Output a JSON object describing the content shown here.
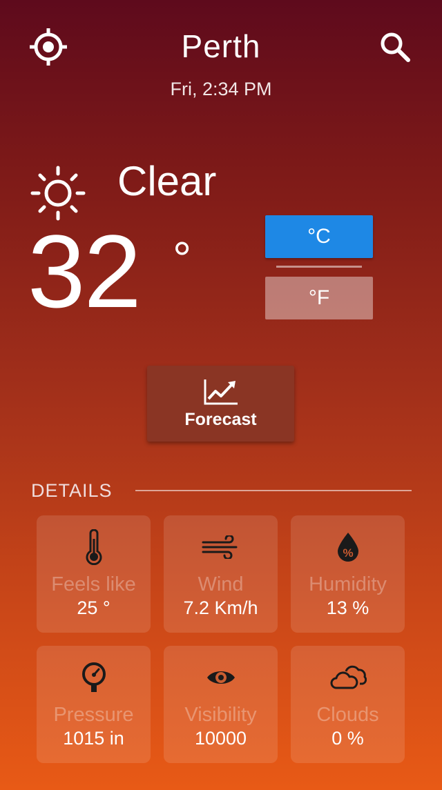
{
  "header": {
    "city": "Perth",
    "datetime": "Fri, 2:34 PM"
  },
  "current": {
    "condition": "Clear",
    "temperature": "32",
    "degree_symbol": "°",
    "condition_icon": "sun-icon"
  },
  "units": {
    "celsius": "°C",
    "fahrenheit": "°F",
    "selected": "celsius"
  },
  "forecast_button": {
    "label": "Forecast",
    "icon": "trending-chart-icon"
  },
  "details": {
    "title": "DETAILS",
    "items": [
      {
        "label": "Feels like",
        "value": "25 °",
        "icon": "thermometer-icon"
      },
      {
        "label": "Wind",
        "value": "7.2 Km/h",
        "icon": "wind-icon"
      },
      {
        "label": "Humidity",
        "value": "13 %",
        "icon": "humidity-drop-icon"
      },
      {
        "label": "Pressure",
        "value": "1015 in",
        "icon": "gauge-icon"
      },
      {
        "label": "Visibility",
        "value": "10000",
        "icon": "eye-icon"
      },
      {
        "label": "Clouds",
        "value": "0 %",
        "icon": "clouds-icon"
      }
    ]
  },
  "colors": {
    "accent": "#1e88e5",
    "icon_dark": "#1a1a1a"
  }
}
